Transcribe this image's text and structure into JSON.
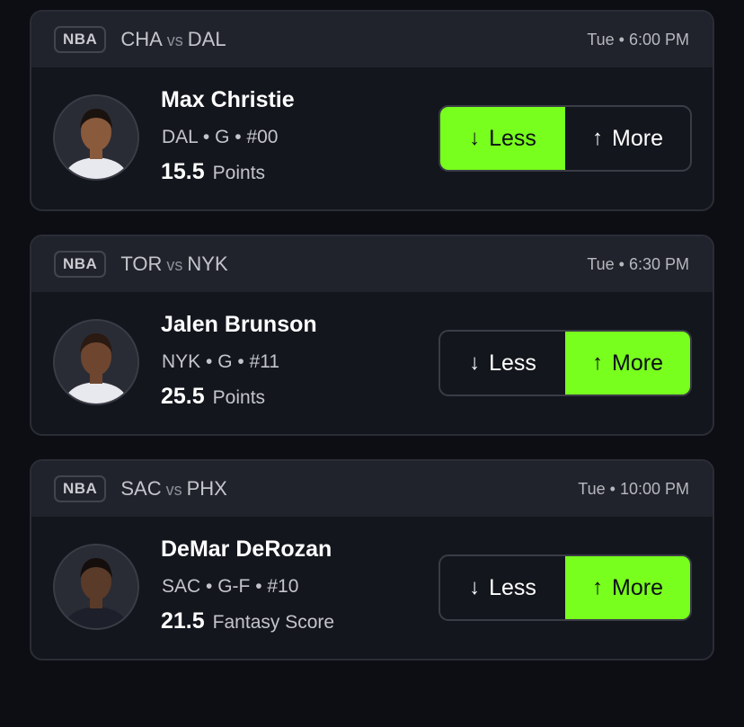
{
  "cards": [
    {
      "league": "NBA",
      "home": "CHA",
      "vs": "vs",
      "away": "DAL",
      "time": "Tue • 6:00 PM",
      "player": {
        "name": "Max Christie",
        "meta": "DAL • G • #00",
        "line": "15.5",
        "stat": "Points",
        "avatar_icon": "player-headshot-icon",
        "jersey_color": "#e8e9ee",
        "skin_color": "#8a5a3c",
        "hair_color": "#1a120e"
      },
      "less_label": "Less",
      "more_label": "More",
      "less_arrow": "↓",
      "more_arrow": "↑",
      "selected": "less"
    },
    {
      "league": "NBA",
      "home": "TOR",
      "vs": "vs",
      "away": "NYK",
      "time": "Tue • 6:30 PM",
      "player": {
        "name": "Jalen Brunson",
        "meta": "NYK • G • #11",
        "line": "25.5",
        "stat": "Points",
        "avatar_icon": "player-headshot-icon",
        "jersey_color": "#e8e9ee",
        "skin_color": "#6e4630",
        "hair_color": "#2a1a12"
      },
      "less_label": "Less",
      "more_label": "More",
      "less_arrow": "↓",
      "more_arrow": "↑",
      "selected": "more"
    },
    {
      "league": "NBA",
      "home": "SAC",
      "vs": "vs",
      "away": "PHX",
      "time": "Tue • 10:00 PM",
      "player": {
        "name": "DeMar DeRozan",
        "meta": "SAC • G-F • #10",
        "line": "21.5",
        "stat": "Fantasy Score",
        "avatar_icon": "player-headshot-icon",
        "jersey_color": "#1d1f2a",
        "skin_color": "#5a3a28",
        "hair_color": "#140e0c"
      },
      "less_label": "Less",
      "more_label": "More",
      "less_arrow": "↓",
      "more_arrow": "↑",
      "selected": "more"
    }
  ],
  "colors": {
    "accent": "#78ff1e",
    "background": "#0d0e14",
    "card": "#14161e",
    "header": "#21232c"
  }
}
